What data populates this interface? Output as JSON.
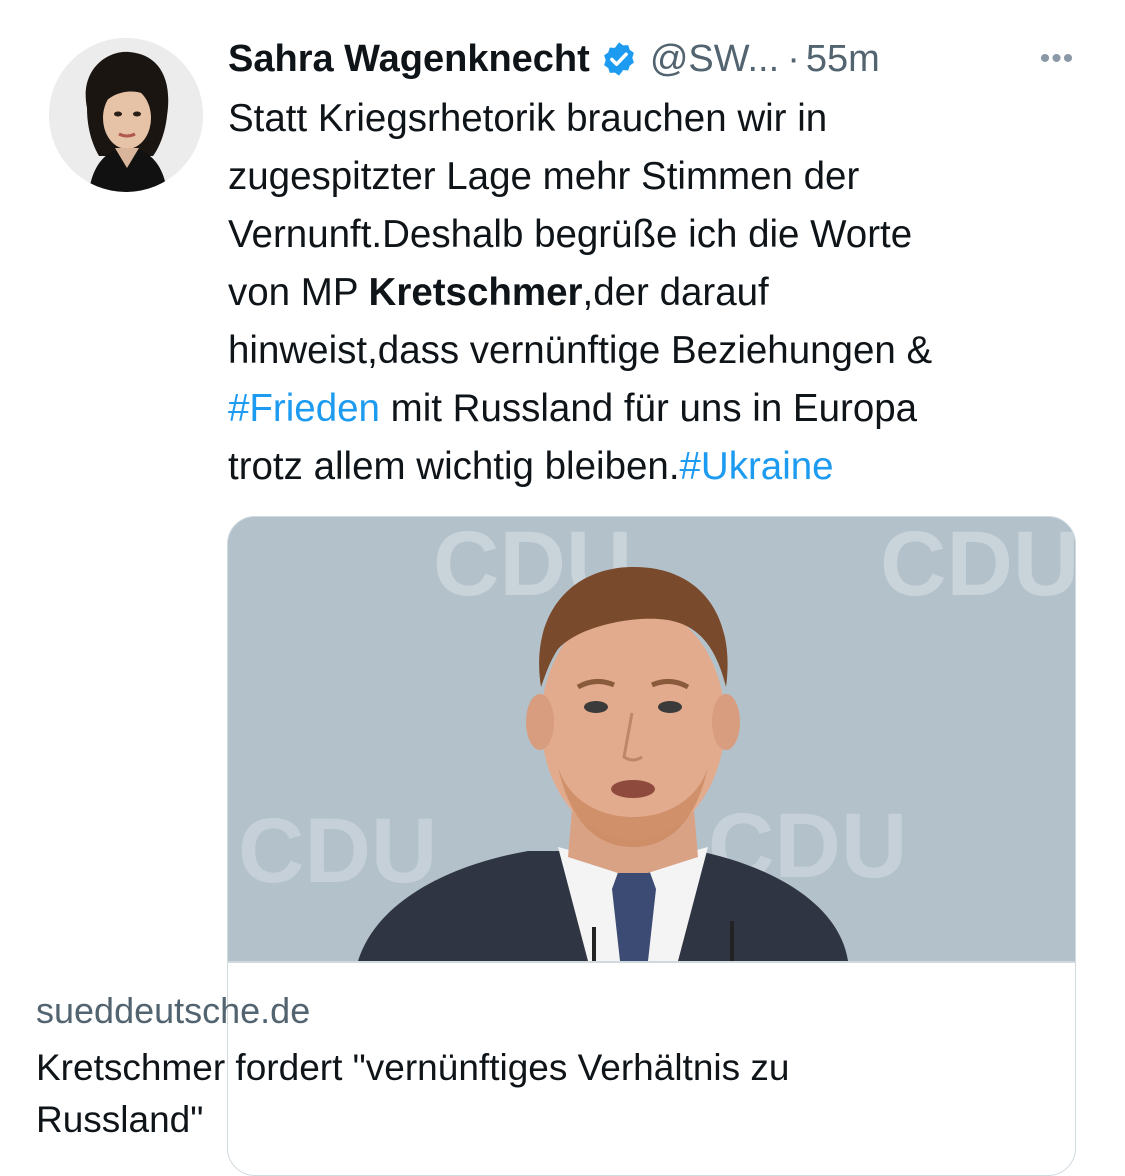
{
  "tweet": {
    "author_name": "Sahra Wagenknecht",
    "handle": "@SW...",
    "separator": "·",
    "time": "55m",
    "more_label": "•••",
    "verified_color": "#1d9bf0",
    "text_lines": [
      [
        {
          "t": "Statt Kriegsrhetorik brauchen wir in"
        }
      ],
      [
        {
          "t": "zugespitzter Lage mehr Stimmen der"
        }
      ],
      [
        {
          "t": "Vernunft.Deshalb begrüße ich die Worte"
        }
      ],
      [
        {
          "t": "von MP "
        },
        {
          "t": "Kretschmer",
          "b": true
        },
        {
          "t": ",der darauf"
        }
      ],
      [
        {
          "t": "hinweist,dass vernünftige Beziehungen &"
        }
      ],
      [
        {
          "t": "#Frieden",
          "h": true
        },
        {
          "t": " mit Russland für uns in Europa"
        }
      ],
      [
        {
          "t": "trotz allem wichtig bleiben."
        },
        {
          "t": "#Ukraine",
          "h": true
        }
      ]
    ]
  },
  "card": {
    "domain": "sueddeutsche.de",
    "title": "Kretschmer fordert \"vernünftiges Verhältnis zu Russland\"",
    "image_backdrop_text": "CDU"
  },
  "colors": {
    "hashtag": "#1d9bf0",
    "secondary_text": "#536471",
    "card_border": "#cfd9de"
  }
}
